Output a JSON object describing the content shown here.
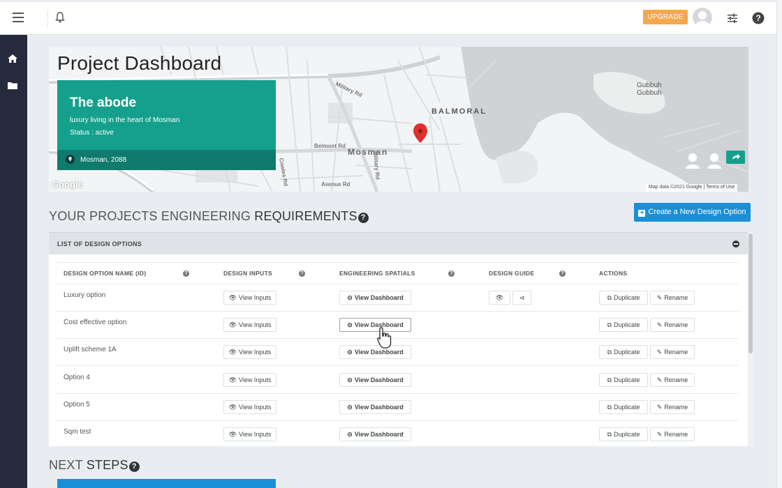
{
  "header": {
    "upgrade_label": "UPGRADE",
    "icons": [
      "menu-icon",
      "bell-icon",
      "avatar",
      "sliders-icon",
      "help-icon"
    ]
  },
  "sidebar": {
    "icons": [
      "home-icon",
      "folder-icon"
    ]
  },
  "page": {
    "title": "Project Dashboard"
  },
  "project": {
    "name": "The abode",
    "description": "luxury living in the heart of Mosman",
    "status": "Status : active",
    "location": "Mosman, 2088"
  },
  "map": {
    "labels": {
      "balmoral": "BALMORAL",
      "mosman": "Mosman",
      "gubbuh": "Gubbuh",
      "gubbuh2": "Gubbuh",
      "military": "Military Rd",
      "belmont": "Belmont Rd",
      "avenue": "Avenue Rd",
      "cowles": "Cowles Rd",
      "military2": "Military Rd"
    },
    "attribution": "Map data ©2021 Google",
    "terms": "Terms of Use",
    "google": "Google"
  },
  "requirements": {
    "heading_prefix": "YOUR PROJECTS ENGINEERING ",
    "heading_bold": "REQUIREMENTS",
    "create_label": "Create a New Design Option"
  },
  "design_options": {
    "panel_title": "LIST OF DESIGN OPTIONS",
    "columns": [
      "DESIGN OPTION NAME (ID)",
      "DESIGN INPUTS",
      "ENGINEERING SPATIALS",
      "DESIGN GUIDE",
      "ACTIONS"
    ],
    "view_inputs_label": "View Inputs",
    "view_dashboard_label": "View Dashboard",
    "duplicate_label": "Duplicate",
    "rename_label": "Rename",
    "rows": [
      {
        "name": "Luxury option"
      },
      {
        "name": "Cost effective option"
      },
      {
        "name": "Uplift scheme 1A"
      },
      {
        "name": "Option 4"
      },
      {
        "name": "Option 5"
      },
      {
        "name": "Sqm test"
      }
    ]
  },
  "next_steps": {
    "heading_prefix": "NEXT ",
    "heading_bold": "STEPS"
  },
  "colors": {
    "teal": "#14a08c",
    "blue": "#1a8fd8",
    "orange": "#f5a74f",
    "sidebar": "#262a3d"
  }
}
